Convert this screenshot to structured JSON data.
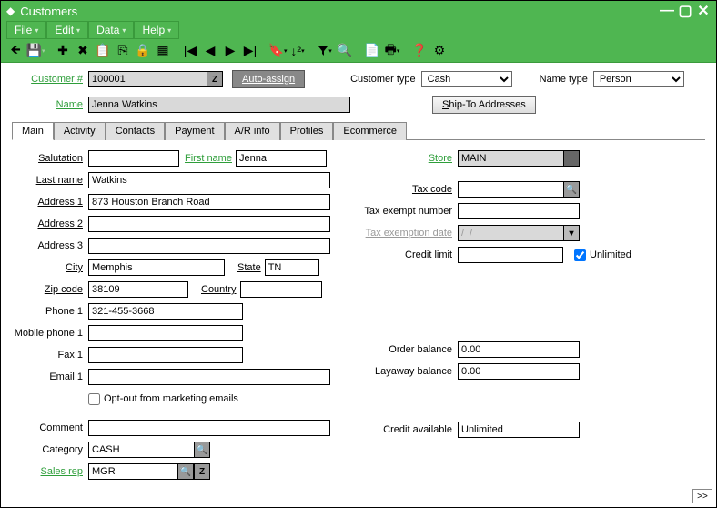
{
  "window": {
    "title": "Customers"
  },
  "menu": {
    "file": "File",
    "edit": "Edit",
    "data": "Data",
    "help": "Help"
  },
  "header": {
    "customer_num_label": "Customer #",
    "customer_num_value": "100001",
    "auto_assign": "Auto-assign",
    "name_label": "Name",
    "name_value": "Jenna Watkins",
    "customer_type_label": "Customer type",
    "customer_type_value": "Cash",
    "ship_to_btn": "Ship-To Addresses",
    "name_type_label": "Name type",
    "name_type_value": "Person"
  },
  "tabs": {
    "main": "Main",
    "activity": "Activity",
    "contacts": "Contacts",
    "payment": "Payment",
    "ar": "A/R info",
    "profiles": "Profiles",
    "ecommerce": "Ecommerce"
  },
  "main_tab": {
    "salutation_label": "Salutation",
    "salutation_value": "",
    "first_name_label": "First name",
    "first_name_value": "Jenna",
    "last_name_label": "Last name",
    "last_name_value": "Watkins",
    "address1_label": "Address 1",
    "address1_value": "873 Houston Branch Road",
    "address2_label": "Address 2",
    "address2_value": "",
    "address3_label": "Address 3",
    "address3_value": "",
    "city_label": "City",
    "city_value": "Memphis",
    "state_label": "State",
    "state_value": "TN",
    "zip_label": "Zip code",
    "zip_value": "38109",
    "country_label": "Country",
    "country_value": "",
    "phone1_label": "Phone 1",
    "phone1_value": "321-455-3668",
    "mobile1_label": "Mobile phone 1",
    "mobile1_value": "",
    "fax1_label": "Fax 1",
    "fax1_value": "",
    "email1_label": "Email 1",
    "email1_value": "",
    "optout_label": "Opt-out from marketing emails",
    "comment_label": "Comment",
    "comment_value": "",
    "category_label": "Category",
    "category_value": "CASH",
    "salesrep_label": "Sales rep",
    "salesrep_value": "MGR",
    "store_label": "Store",
    "store_value": "MAIN",
    "taxcode_label": "Tax code",
    "taxcode_value": "",
    "taxexempt_label": "Tax exempt number",
    "taxexempt_value": "",
    "taxexemptdate_label": "Tax exemption date",
    "taxexemptdate_value": "/  /",
    "creditlimit_label": "Credit limit",
    "creditlimit_value": "",
    "unlimited_label": "Unlimited",
    "orderbal_label": "Order balance",
    "orderbal_value": "0.00",
    "layawaybal_label": "Layaway balance",
    "layawaybal_value": "0.00",
    "creditavail_label": "Credit available",
    "creditavail_value": "Unlimited"
  },
  "icons": {
    "z": "Z",
    "search": "🔍"
  }
}
